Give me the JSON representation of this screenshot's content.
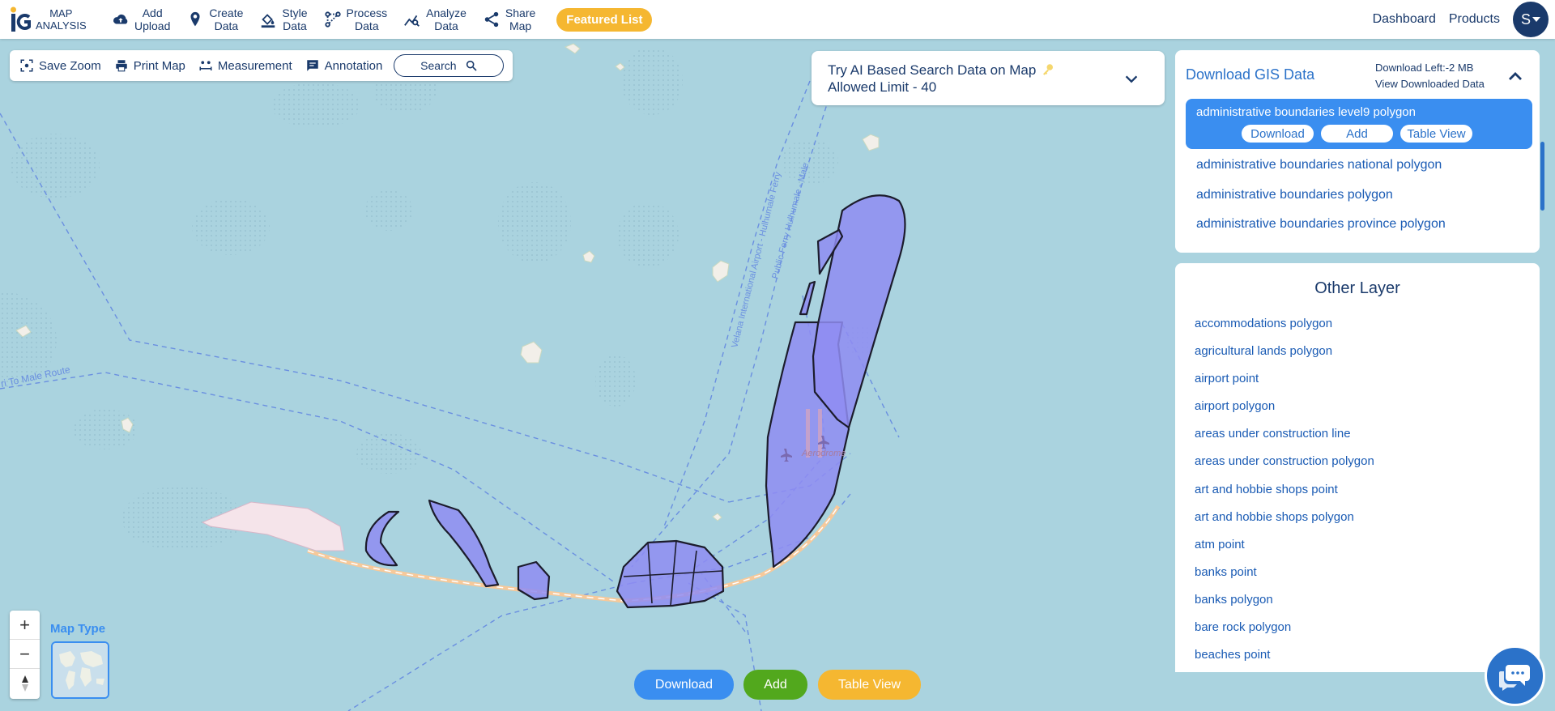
{
  "header": {
    "logo_line1": "MAP",
    "logo_line2": "ANALYSIS",
    "nav": [
      {
        "line1": "Add",
        "line2": "Upload",
        "icon": "cloud-upload-icon"
      },
      {
        "line1": "Create",
        "line2": "Data",
        "icon": "map-pin-icon"
      },
      {
        "line1": "Style",
        "line2": "Data",
        "icon": "paint-bucket-icon"
      },
      {
        "line1": "Process",
        "line2": "Data",
        "icon": "process-icon"
      },
      {
        "line1": "Analyze",
        "line2": "Data",
        "icon": "analyze-icon"
      },
      {
        "line1": "Share",
        "line2": "Map",
        "icon": "share-icon"
      }
    ],
    "featured_label": "Featured List",
    "dashboard_label": "Dashboard",
    "products_label": "Products",
    "avatar_letter": "S"
  },
  "toolbar": {
    "save_zoom": "Save Zoom",
    "print_map": "Print Map",
    "measurement": "Measurement",
    "annotation": "Annotation",
    "search_label": "Search"
  },
  "ai_search": {
    "line1": "Try AI Based Search Data on Map",
    "line2": "Allowed Limit - 40"
  },
  "download_panel": {
    "title": "Download GIS Data",
    "download_left": "Download Left:-2 MB",
    "view_downloaded": "View Downloaded Data",
    "selected_layer": "administrative boundaries level9 polygon",
    "selected_buttons": {
      "download": "Download",
      "add": "Add",
      "table_view": "Table View"
    },
    "layers": [
      "administrative boundaries national polygon",
      "administrative boundaries polygon",
      "administrative boundaries province polygon"
    ]
  },
  "other_layers": {
    "title": "Other Layer",
    "items": [
      "accommodations polygon",
      "agricultural lands polygon",
      "airport point",
      "airport polygon",
      "areas under construction line",
      "areas under construction polygon",
      "art and hobbie shops point",
      "art and hobbie shops polygon",
      "atm point",
      "banks point",
      "banks polygon",
      "bare rock polygon",
      "beaches point"
    ]
  },
  "bottom_buttons": {
    "download": "Download",
    "add": "Add",
    "table_view": "Table View"
  },
  "map": {
    "map_type_label": "Map Type",
    "route_label_1": "ri To Male Route",
    "route_label_2": "Velana International Airport - Hulhumale Ferry",
    "route_label_3": "Public Ferry Hulhumale - Male",
    "airport_label": "Aerodrome"
  },
  "zoom": {
    "plus": "+",
    "minus": "−"
  },
  "colors": {
    "water": "#aad3df",
    "polygon_fill": "#8f8cf2",
    "accent_blue": "#3a8ef0",
    "navy": "#1a3a6b",
    "featured_orange": "#f5b731",
    "add_green": "#52a81d"
  }
}
